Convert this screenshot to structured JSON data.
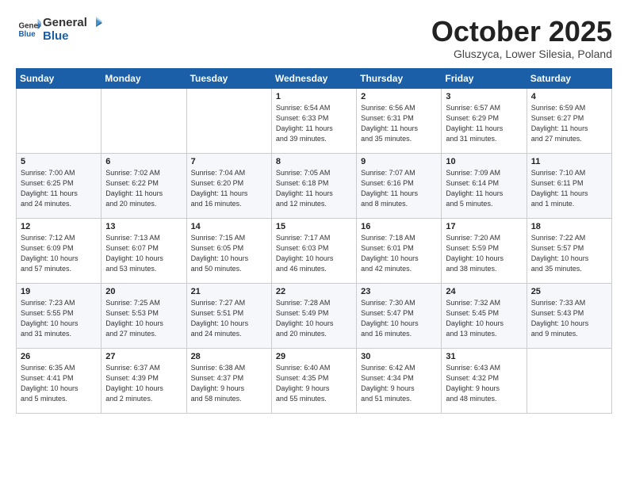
{
  "header": {
    "logo_general": "General",
    "logo_blue": "Blue",
    "month_title": "October 2025",
    "location": "Gluszyca, Lower Silesia, Poland"
  },
  "days_of_week": [
    "Sunday",
    "Monday",
    "Tuesday",
    "Wednesday",
    "Thursday",
    "Friday",
    "Saturday"
  ],
  "weeks": [
    [
      {
        "day": "",
        "info": ""
      },
      {
        "day": "",
        "info": ""
      },
      {
        "day": "",
        "info": ""
      },
      {
        "day": "1",
        "info": "Sunrise: 6:54 AM\nSunset: 6:33 PM\nDaylight: 11 hours\nand 39 minutes."
      },
      {
        "day": "2",
        "info": "Sunrise: 6:56 AM\nSunset: 6:31 PM\nDaylight: 11 hours\nand 35 minutes."
      },
      {
        "day": "3",
        "info": "Sunrise: 6:57 AM\nSunset: 6:29 PM\nDaylight: 11 hours\nand 31 minutes."
      },
      {
        "day": "4",
        "info": "Sunrise: 6:59 AM\nSunset: 6:27 PM\nDaylight: 11 hours\nand 27 minutes."
      }
    ],
    [
      {
        "day": "5",
        "info": "Sunrise: 7:00 AM\nSunset: 6:25 PM\nDaylight: 11 hours\nand 24 minutes."
      },
      {
        "day": "6",
        "info": "Sunrise: 7:02 AM\nSunset: 6:22 PM\nDaylight: 11 hours\nand 20 minutes."
      },
      {
        "day": "7",
        "info": "Sunrise: 7:04 AM\nSunset: 6:20 PM\nDaylight: 11 hours\nand 16 minutes."
      },
      {
        "day": "8",
        "info": "Sunrise: 7:05 AM\nSunset: 6:18 PM\nDaylight: 11 hours\nand 12 minutes."
      },
      {
        "day": "9",
        "info": "Sunrise: 7:07 AM\nSunset: 6:16 PM\nDaylight: 11 hours\nand 8 minutes."
      },
      {
        "day": "10",
        "info": "Sunrise: 7:09 AM\nSunset: 6:14 PM\nDaylight: 11 hours\nand 5 minutes."
      },
      {
        "day": "11",
        "info": "Sunrise: 7:10 AM\nSunset: 6:11 PM\nDaylight: 11 hours\nand 1 minute."
      }
    ],
    [
      {
        "day": "12",
        "info": "Sunrise: 7:12 AM\nSunset: 6:09 PM\nDaylight: 10 hours\nand 57 minutes."
      },
      {
        "day": "13",
        "info": "Sunrise: 7:13 AM\nSunset: 6:07 PM\nDaylight: 10 hours\nand 53 minutes."
      },
      {
        "day": "14",
        "info": "Sunrise: 7:15 AM\nSunset: 6:05 PM\nDaylight: 10 hours\nand 50 minutes."
      },
      {
        "day": "15",
        "info": "Sunrise: 7:17 AM\nSunset: 6:03 PM\nDaylight: 10 hours\nand 46 minutes."
      },
      {
        "day": "16",
        "info": "Sunrise: 7:18 AM\nSunset: 6:01 PM\nDaylight: 10 hours\nand 42 minutes."
      },
      {
        "day": "17",
        "info": "Sunrise: 7:20 AM\nSunset: 5:59 PM\nDaylight: 10 hours\nand 38 minutes."
      },
      {
        "day": "18",
        "info": "Sunrise: 7:22 AM\nSunset: 5:57 PM\nDaylight: 10 hours\nand 35 minutes."
      }
    ],
    [
      {
        "day": "19",
        "info": "Sunrise: 7:23 AM\nSunset: 5:55 PM\nDaylight: 10 hours\nand 31 minutes."
      },
      {
        "day": "20",
        "info": "Sunrise: 7:25 AM\nSunset: 5:53 PM\nDaylight: 10 hours\nand 27 minutes."
      },
      {
        "day": "21",
        "info": "Sunrise: 7:27 AM\nSunset: 5:51 PM\nDaylight: 10 hours\nand 24 minutes."
      },
      {
        "day": "22",
        "info": "Sunrise: 7:28 AM\nSunset: 5:49 PM\nDaylight: 10 hours\nand 20 minutes."
      },
      {
        "day": "23",
        "info": "Sunrise: 7:30 AM\nSunset: 5:47 PM\nDaylight: 10 hours\nand 16 minutes."
      },
      {
        "day": "24",
        "info": "Sunrise: 7:32 AM\nSunset: 5:45 PM\nDaylight: 10 hours\nand 13 minutes."
      },
      {
        "day": "25",
        "info": "Sunrise: 7:33 AM\nSunset: 5:43 PM\nDaylight: 10 hours\nand 9 minutes."
      }
    ],
    [
      {
        "day": "26",
        "info": "Sunrise: 6:35 AM\nSunset: 4:41 PM\nDaylight: 10 hours\nand 5 minutes."
      },
      {
        "day": "27",
        "info": "Sunrise: 6:37 AM\nSunset: 4:39 PM\nDaylight: 10 hours\nand 2 minutes."
      },
      {
        "day": "28",
        "info": "Sunrise: 6:38 AM\nSunset: 4:37 PM\nDaylight: 9 hours\nand 58 minutes."
      },
      {
        "day": "29",
        "info": "Sunrise: 6:40 AM\nSunset: 4:35 PM\nDaylight: 9 hours\nand 55 minutes."
      },
      {
        "day": "30",
        "info": "Sunrise: 6:42 AM\nSunset: 4:34 PM\nDaylight: 9 hours\nand 51 minutes."
      },
      {
        "day": "31",
        "info": "Sunrise: 6:43 AM\nSunset: 4:32 PM\nDaylight: 9 hours\nand 48 minutes."
      },
      {
        "day": "",
        "info": ""
      }
    ]
  ]
}
